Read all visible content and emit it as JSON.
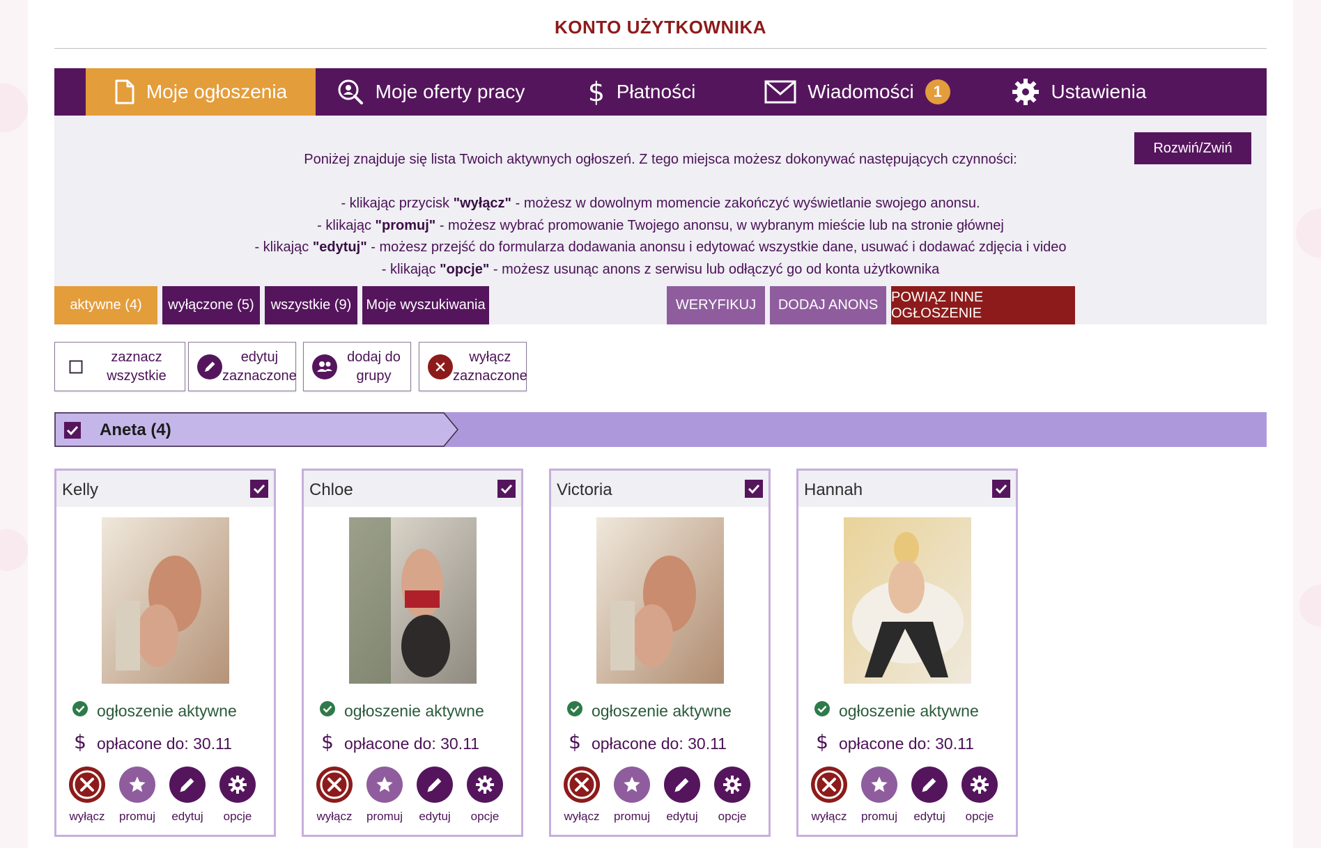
{
  "page": {
    "title": "KONTO UŻYTKOWNIKA"
  },
  "nav": {
    "items": [
      {
        "label": "Moje ogłoszenia",
        "icon": "document-icon",
        "active": true
      },
      {
        "label": "Moje oferty pracy",
        "icon": "search-person-icon",
        "active": false
      },
      {
        "label": "Płatności",
        "icon": "dollar-icon",
        "active": false
      },
      {
        "label": "Wiadomości",
        "icon": "envelope-icon",
        "active": false,
        "badge": "1"
      },
      {
        "label": "Ustawienia",
        "icon": "gear-icon",
        "active": false
      }
    ]
  },
  "info": {
    "toggle_label": "Rozwiń/Zwiń",
    "intro": "Poniżej znajduje się lista Twoich aktywnych ogłoszeń. Z tego miejsca możesz dokonywać następujących czynności:",
    "lines": [
      {
        "pre": "- klikając przycisk ",
        "keyword": "\"wyłącz\"",
        "post": " - możesz w dowolnym momencie zakończyć wyświetlanie swojego anonsu."
      },
      {
        "pre": "- klikając ",
        "keyword": "\"promuj\"",
        "post": " - możesz wybrać promowanie Twojego anonsu, w wybranym mieście lub na stronie głównej"
      },
      {
        "pre": "- klikając ",
        "keyword": "\"edytuj\"",
        "post": " - możesz przejść do formularza dodawania anonsu i edytować wszystkie dane, usuwać i dodawać zdjęcia i video"
      },
      {
        "pre": "- klikając ",
        "keyword": "\"opcje\"",
        "post": " - możesz usunąc anons z serwisu lub odłączyć go od konta użytkownika"
      }
    ]
  },
  "filters": {
    "active": "aktywne (4)",
    "disabled": "wyłączone (5)",
    "all": "wszystkie (9)",
    "searches": "Moje wyszukiwania"
  },
  "actions": {
    "verify": "WERYFIKUJ",
    "add": "DODAJ ANONS",
    "link": "POWIĄZ INNE OGŁOSZENIE"
  },
  "tools": {
    "select_all": [
      "zaznacz",
      "wszystkie"
    ],
    "edit_selected": [
      "edytuj",
      "zaznaczone"
    ],
    "add_to_group": [
      "dodaj do",
      "grupy"
    ],
    "disable_selected": [
      "wyłącz",
      "zaznaczone"
    ]
  },
  "group": {
    "name": "Aneta (4)",
    "checked": true
  },
  "cards": [
    {
      "name": "Kelly",
      "status": "ogłoszenie aktywne",
      "paid": "opłacone do: 30.11",
      "photo": "photo-kelly"
    },
    {
      "name": "Chloe",
      "status": "ogłoszenie aktywne",
      "paid": "opłacone do: 30.11",
      "photo": "photo-chloe"
    },
    {
      "name": "Victoria",
      "status": "ogłoszenie aktywne",
      "paid": "opłacone do: 30.11",
      "photo": "photo-victoria"
    },
    {
      "name": "Hannah",
      "status": "ogłoszenie aktywne",
      "paid": "opłacone do: 30.11",
      "photo": "photo-hannah"
    }
  ],
  "card_actions": {
    "disable": "wyłącz",
    "promote": "promuj",
    "edit": "edytuj",
    "options": "opcje"
  },
  "colors": {
    "nav_bg": "#55155d",
    "accent_orange": "#e39d3b",
    "title_red": "#8d1b1b",
    "status_green": "#2a5a3a",
    "group_purple": "#ae98dc"
  }
}
